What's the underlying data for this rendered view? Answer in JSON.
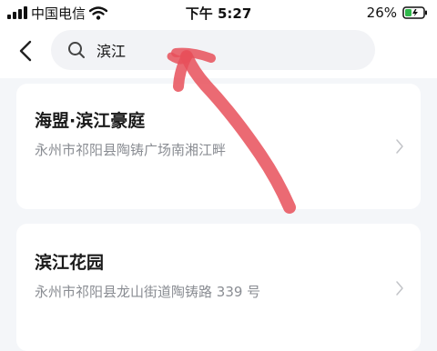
{
  "status_bar": {
    "carrier": "中国电信",
    "time": "下午 5:27",
    "battery": "26%"
  },
  "search": {
    "query": "滨江"
  },
  "results": [
    {
      "title": "海盟·滨江豪庭",
      "address": "永州市祁阳县陶铸广场南湘江畔"
    },
    {
      "title": "滨江花园",
      "address": "永州市祁阳县龙山街道陶铸路 339 号"
    }
  ],
  "colors": {
    "accent_overlay": "#e8505b",
    "battery_fill": "#2fb84a",
    "text_primary": "#1a1a1a",
    "text_secondary": "#8a8d93"
  },
  "icons": [
    "signal-icon",
    "wifi-icon",
    "battery-icon",
    "back-arrow-icon",
    "search-icon",
    "chevron-right-icon"
  ]
}
